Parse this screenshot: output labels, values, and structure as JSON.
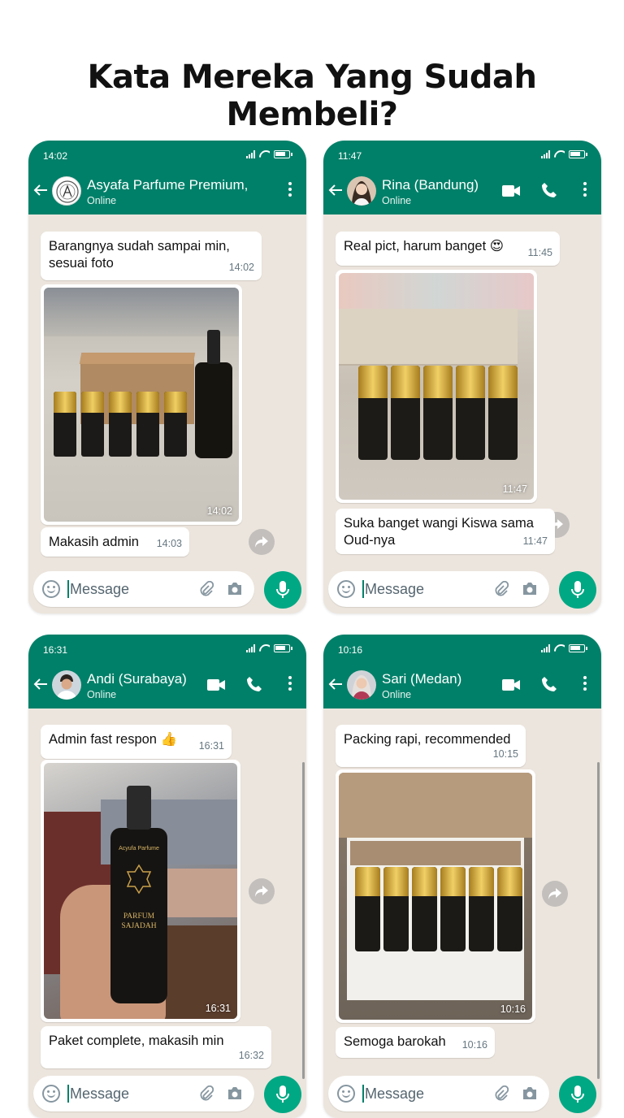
{
  "page_title": "Kata Mereka Yang Sudah Membeli?",
  "input_placeholder": "Message",
  "chats": [
    {
      "status_time": "14:02",
      "contact_name": "Asyafa Parfume Premium,",
      "contact_status": "Online",
      "messages": [
        {
          "text_line1": "Barangnya sudah sampai min,",
          "text_line2": "sesuai foto",
          "time": "14:02"
        },
        {
          "image_time": "14:02"
        },
        {
          "text": "Makasih admin",
          "time": "14:03"
        }
      ]
    },
    {
      "status_time": "11:47",
      "contact_name": "Rina (Bandung)",
      "contact_status": "Online",
      "messages": [
        {
          "text": "Real pict, harum banget 😍",
          "time": "11:45"
        },
        {
          "image_time": "11:47"
        },
        {
          "text_line1": "Suka banget wangi Kiswa sama",
          "text_line2": "Oud-nya",
          "time": "11:47"
        }
      ]
    },
    {
      "status_time": "16:31",
      "contact_name": "Andi (Surabaya)",
      "contact_status": "Online",
      "messages": [
        {
          "text": "Admin fast respon 👍",
          "time": "16:31"
        },
        {
          "image_time": "16:31",
          "bottle_brand": "Acyufa Parfume",
          "bottle_name_1": "PARFUM",
          "bottle_name_2": "SAJADAH"
        },
        {
          "text": "Paket complete, makasih min",
          "time": "16:32"
        }
      ]
    },
    {
      "status_time": "10:16",
      "contact_name": "Sari (Medan)",
      "contact_status": "Online",
      "messages": [
        {
          "text": "Packing rapi, recommended",
          "time": "10:15"
        },
        {
          "image_time": "10:16"
        },
        {
          "text": "Semoga barokah",
          "time": "10:16"
        }
      ]
    }
  ],
  "colors": {
    "header": "#008069",
    "mic": "#00a884",
    "chat_bg": "#ece5dd"
  },
  "icons": [
    "back-arrow-icon",
    "video-call-icon",
    "phone-call-icon",
    "menu-dots-icon",
    "emoji-icon",
    "attach-icon",
    "camera-icon",
    "mic-icon",
    "forward-icon",
    "signal-icon",
    "wifi-icon",
    "battery-icon"
  ]
}
